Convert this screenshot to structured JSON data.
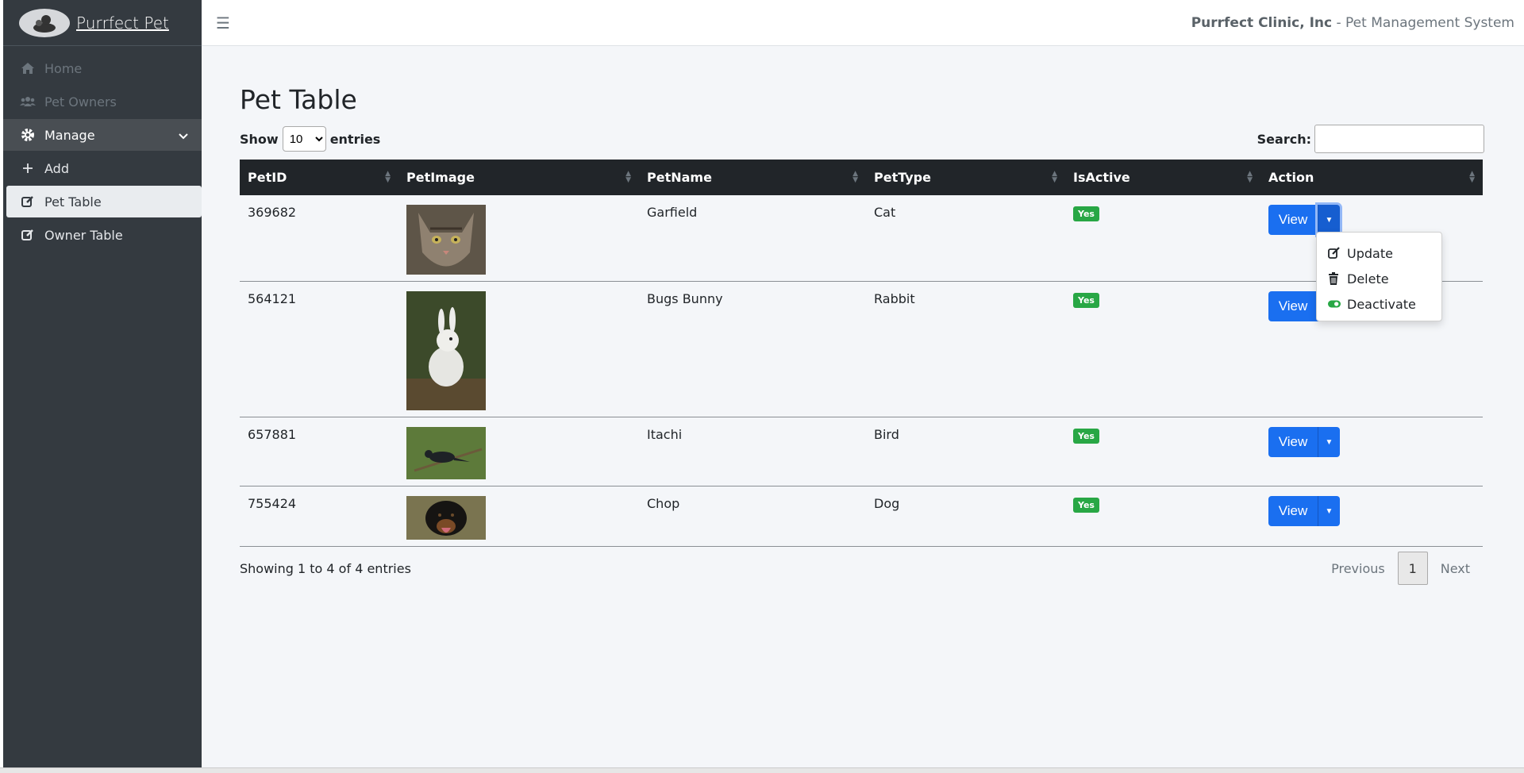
{
  "brand": {
    "name": "Purrfect Pet"
  },
  "sidebar": {
    "items": [
      {
        "label": "Home",
        "icon": "home-icon"
      },
      {
        "label": "Pet Owners",
        "icon": "users-icon"
      },
      {
        "label": "Manage",
        "icon": "gear-icon"
      },
      {
        "label": "Add",
        "icon": "plus-icon"
      },
      {
        "label": "Pet Table",
        "icon": "edit-icon"
      },
      {
        "label": "Owner Table",
        "icon": "edit-icon"
      }
    ]
  },
  "header": {
    "company": "Purrfect Clinic, Inc",
    "suffix": " - Pet Management System"
  },
  "page": {
    "title": "Pet Table"
  },
  "controls": {
    "show_label": "Show",
    "entries_value": "10",
    "entries_label": "entries",
    "search_label": "Search:"
  },
  "table": {
    "columns": [
      "PetID",
      "PetImage",
      "PetName",
      "PetType",
      "IsActive",
      "Action"
    ],
    "rows": [
      {
        "id": "369682",
        "name": "Garfield",
        "type": "Cat",
        "active": "Yes"
      },
      {
        "id": "564121",
        "name": "Bugs Bunny",
        "type": "Rabbit",
        "active": "Yes"
      },
      {
        "id": "657881",
        "name": "Itachi",
        "type": "Bird",
        "active": "Yes"
      },
      {
        "id": "755424",
        "name": "Chop",
        "type": "Dog",
        "active": "Yes"
      }
    ],
    "view_label": "View"
  },
  "dropdown": {
    "items": [
      "Update",
      "Delete",
      "Deactivate"
    ]
  },
  "footer": {
    "info": "Showing 1 to 4 of 4 entries",
    "previous": "Previous",
    "page": "1",
    "next": "Next"
  },
  "colors": {
    "sidebar": "#343a40",
    "primary": "#1a6ff0",
    "success": "#28a745",
    "header": "#212529"
  }
}
